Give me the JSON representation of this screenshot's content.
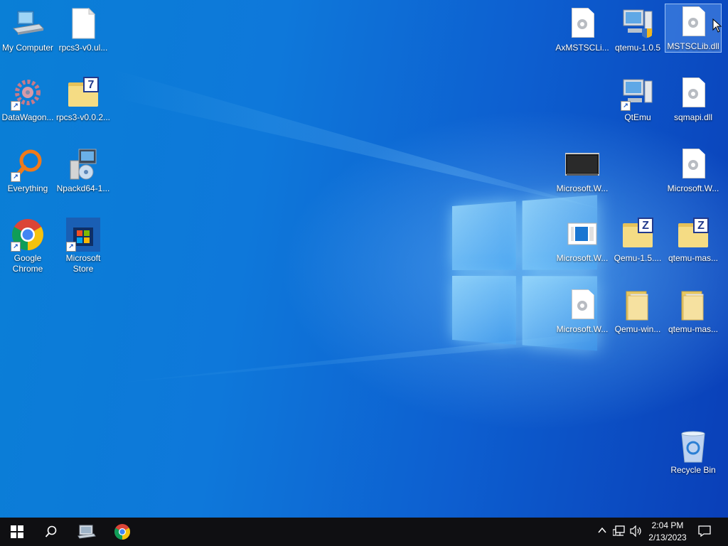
{
  "desktop": {
    "left_icons": [
      {
        "label": "My Computer",
        "icon": "computer-icon"
      },
      {
        "label": "rpcs3-v0.ul...",
        "icon": "blank-file-icon"
      },
      {
        "label": "DataWagon...",
        "icon": "datawagon-icon"
      },
      {
        "label": "rpcs3-v0.0.2...",
        "icon": "7zip-folder-icon"
      },
      {
        "label": "Everything",
        "icon": "magnifier-icon"
      },
      {
        "label": "Npackd64-1...",
        "icon": "installer-icon"
      },
      {
        "label": "Google Chrome",
        "icon": "chrome-icon"
      },
      {
        "label": "Microsoft Store",
        "icon": "store-icon"
      }
    ],
    "right_icons": [
      {
        "label": "AxMSTSCLi...",
        "icon": "dll-file-icon"
      },
      {
        "label": "qtemu-1.0.5",
        "icon": "qtemu-installer-icon"
      },
      {
        "label": "MSTSCLib.dll",
        "icon": "dll-file-icon"
      },
      {
        "label": "QtEmu",
        "icon": "qtemu-icon"
      },
      {
        "label": "sqmapi.dll",
        "icon": "dll-file-icon"
      },
      {
        "label": "Microsoft.W...",
        "icon": "monitor-icon"
      },
      {
        "label": "Microsoft.W...",
        "icon": "dll-file-icon"
      },
      {
        "label": "Microsoft.W...",
        "icon": "app-window-icon"
      },
      {
        "label": "Qemu-1.5....",
        "icon": "zip-folder-icon"
      },
      {
        "label": "qtemu-mas...",
        "icon": "zip-folder-icon"
      },
      {
        "label": "Microsoft.W...",
        "icon": "dll-file-icon"
      },
      {
        "label": "Qemu-win...",
        "icon": "folder-icon"
      },
      {
        "label": "qtemu-mas...",
        "icon": "folder-icon"
      },
      {
        "label": "Recycle Bin",
        "icon": "recycle-bin-icon"
      }
    ]
  },
  "taskbar": {
    "start": "windows-start-icon",
    "search": "search-icon",
    "pinned": [
      "computer-icon",
      "chrome-icon"
    ],
    "tray": [
      "chevron-up-icon",
      "network-icon",
      "volume-icon"
    ],
    "clock_time": "2:04 PM",
    "clock_date": "2/13/2023",
    "notifications": "notification-icon"
  },
  "colors": {
    "taskbar": "#0f0f12",
    "desktop_blue": "#0e78da",
    "selection": "#78b4ff"
  }
}
